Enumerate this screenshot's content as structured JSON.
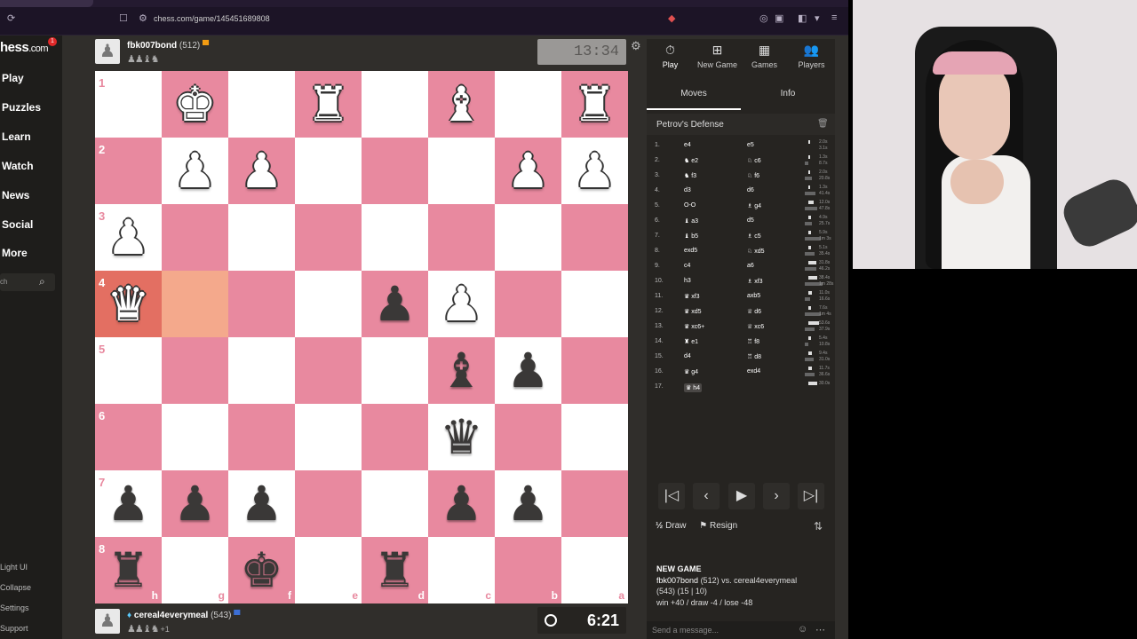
{
  "browser": {
    "url": "chess.com/game/145451689808"
  },
  "sidebar": {
    "logo": "hess",
    "logo_suffix": ".com",
    "badge": "1",
    "nav": [
      "Play",
      "Puzzles",
      "Learn",
      "Watch",
      "News",
      "Social",
      "More"
    ],
    "search_placeholder": "ch",
    "footer": [
      "Light UI",
      "Collapse",
      "Settings",
      "Support"
    ]
  },
  "top_player": {
    "name": "fbk007bond",
    "rating": "(512)",
    "captured": "♟♟♝♞",
    "clock": "13:34"
  },
  "bottom_player": {
    "name": "cereal4everymeal",
    "rating": "(543)",
    "captured": "♟♟♝♞",
    "advantage": "+1",
    "clock": "6:21"
  },
  "board": {
    "ranks": [
      "1",
      "2",
      "3",
      "4",
      "5",
      "6",
      "7",
      "8"
    ],
    "files": [
      "h",
      "g",
      "f",
      "e",
      "d",
      "c",
      "b",
      "a"
    ],
    "pieces": {
      "0,1": "wK",
      "0,3": "wR",
      "0,5": "wB",
      "0,7": "wR",
      "1,1": "wP",
      "1,2": "wP",
      "1,6": "wP",
      "1,7": "wP",
      "2,0": "wP",
      "3,0": "wQ",
      "3,4": "bP",
      "3,5": "wP",
      "4,5": "bB",
      "4,6": "bP",
      "5,5": "bQ",
      "6,0": "bP",
      "6,1": "bP",
      "6,2": "bP",
      "6,5": "bP",
      "6,6": "bP",
      "7,0": "bR",
      "7,2": "bK",
      "7,4": "bR"
    },
    "highlights": {
      "3,0": "hl2",
      "3,1": "hl"
    }
  },
  "panel": {
    "tabs": [
      {
        "icon": "⏱",
        "label": "Play"
      },
      {
        "icon": "⊞",
        "label": "New Game"
      },
      {
        "icon": "▦",
        "label": "Games"
      },
      {
        "icon": "👥",
        "label": "Players"
      }
    ],
    "subtabs": [
      "Moves",
      "Info"
    ],
    "opening": "Petrov's Defense",
    "moves": [
      {
        "no": "1.",
        "w": "e4",
        "b": "e5",
        "wt": "2.0s",
        "bt": "3.1s",
        "bw1": 2,
        "bw2": 0
      },
      {
        "no": "2.",
        "w": "♞ e2",
        "b": "♘ c6",
        "wt": "1.3s",
        "bt": "8.7s",
        "bw1": 2,
        "bw2": 4
      },
      {
        "no": "3.",
        "w": "♞ f3",
        "b": "♘ f6",
        "wt": "2.0s",
        "bt": "20.8s",
        "bw1": 2,
        "bw2": 8
      },
      {
        "no": "4.",
        "w": "d3",
        "b": "d6",
        "wt": "1.3s",
        "bt": "41.4s",
        "bw1": 2,
        "bw2": 12
      },
      {
        "no": "5.",
        "w": "O-O",
        "b": "♗ g4",
        "wt": "12.0s",
        "bt": "47.8s",
        "bw1": 6,
        "bw2": 14
      },
      {
        "no": "6.",
        "w": "♝ a3",
        "b": "d5",
        "wt": "4.9s",
        "bt": "25.7s",
        "bw1": 3,
        "bw2": 8
      },
      {
        "no": "7.",
        "w": "♝ b5",
        "b": "♗ c5",
        "wt": "5.9s",
        "bt": "1m 3s",
        "bw1": 3,
        "bw2": 18
      },
      {
        "no": "8.",
        "w": "exd5",
        "b": "♘ xd5",
        "wt": "5.1s",
        "bt": "35.4s",
        "bw1": 3,
        "bw2": 11
      },
      {
        "no": "9.",
        "w": "c4",
        "b": "a6",
        "wt": "31.8s",
        "bt": "46.2s",
        "bw1": 9,
        "bw2": 13
      },
      {
        "no": "10.",
        "w": "h3",
        "b": "♗ xf3",
        "wt": "38.4s",
        "bt": "1m 28s",
        "bw1": 10,
        "bw2": 20
      },
      {
        "no": "11.",
        "w": "♛ xf3",
        "b": "axb5",
        "wt": "11.0s",
        "bt": "16.6s",
        "bw1": 4,
        "bw2": 6
      },
      {
        "no": "12.",
        "w": "♛ xd5",
        "b": "♕ d6",
        "wt": "7.6s",
        "bt": "1m 4s",
        "bw1": 3,
        "bw2": 18
      },
      {
        "no": "13.",
        "w": "♛ xc6+",
        "b": "♕ xc6",
        "wt": "53.6s",
        "bt": "37.9s",
        "bw1": 12,
        "bw2": 11
      },
      {
        "no": "14.",
        "w": "♜ e1",
        "b": "♖ f8",
        "wt": "5.4s",
        "bt": "10.8s",
        "bw1": 3,
        "bw2": 4
      },
      {
        "no": "15.",
        "w": "d4",
        "b": "♖ d8",
        "wt": "9.4s",
        "bt": "31.0s",
        "bw1": 4,
        "bw2": 10
      },
      {
        "no": "16.",
        "w": "♛ g4",
        "b": "exd4",
        "wt": "11.7s",
        "bt": "36.6s",
        "bw1": 4,
        "bw2": 11
      },
      {
        "no": "17.",
        "w": "♛ h4",
        "b": "",
        "wt": "30.0s",
        "bt": "",
        "bw1": 10,
        "bw2": 0
      }
    ],
    "nav_buttons": [
      "|◁",
      "‹",
      "▶",
      "›",
      "▷|"
    ],
    "draw_label": "Draw",
    "draw_icon": "½",
    "resign_label": "Resign",
    "resign_icon": "⚑",
    "info_title": "NEW GAME",
    "info_line1_name": "fbk007bond",
    "info_line1_rest": "(512) vs. cereal4everymeal",
    "info_line2": "(543) (15 | 10)",
    "info_line3": "win +40 / draw -4 / lose -48",
    "message_placeholder": "Send a message..."
  }
}
